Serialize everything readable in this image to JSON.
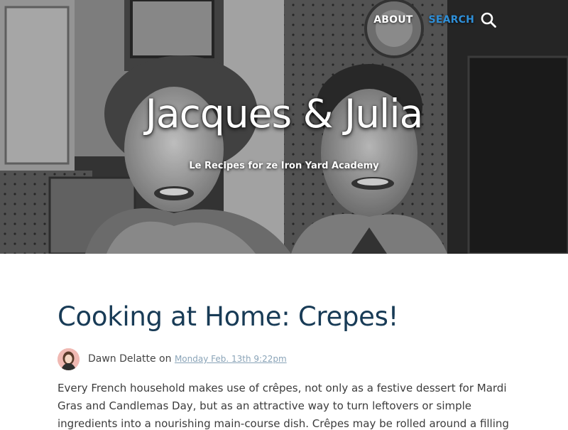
{
  "site": {
    "title": "Jacques & Julia",
    "subtitle": "Le Recipes for ze Iron Yard Academy"
  },
  "nav": {
    "about_label": "ABOUT",
    "search_label": "SEARCH",
    "search_color": "#2f8fd8"
  },
  "post": {
    "title": "Cooking at Home: Crepes!",
    "author": "Dawn Delatte",
    "on_word": "on",
    "date": "Monday Feb. 13th 9:22pm",
    "body": "Every French household makes use of crêpes, not only as a festive dessert for Mardi Gras and Candlemas Day, but as an attractive way to turn leftovers or simple ingredients into a nourishing main-course dish. Crêpes may be rolled around a filling of fish, meat, or vegetables,"
  },
  "colors": {
    "title": "#183b56",
    "date_link": "#8aa4b8",
    "body_text": "#3c3c3c"
  },
  "icons": {
    "search": "search-icon",
    "avatar": "author-avatar"
  }
}
